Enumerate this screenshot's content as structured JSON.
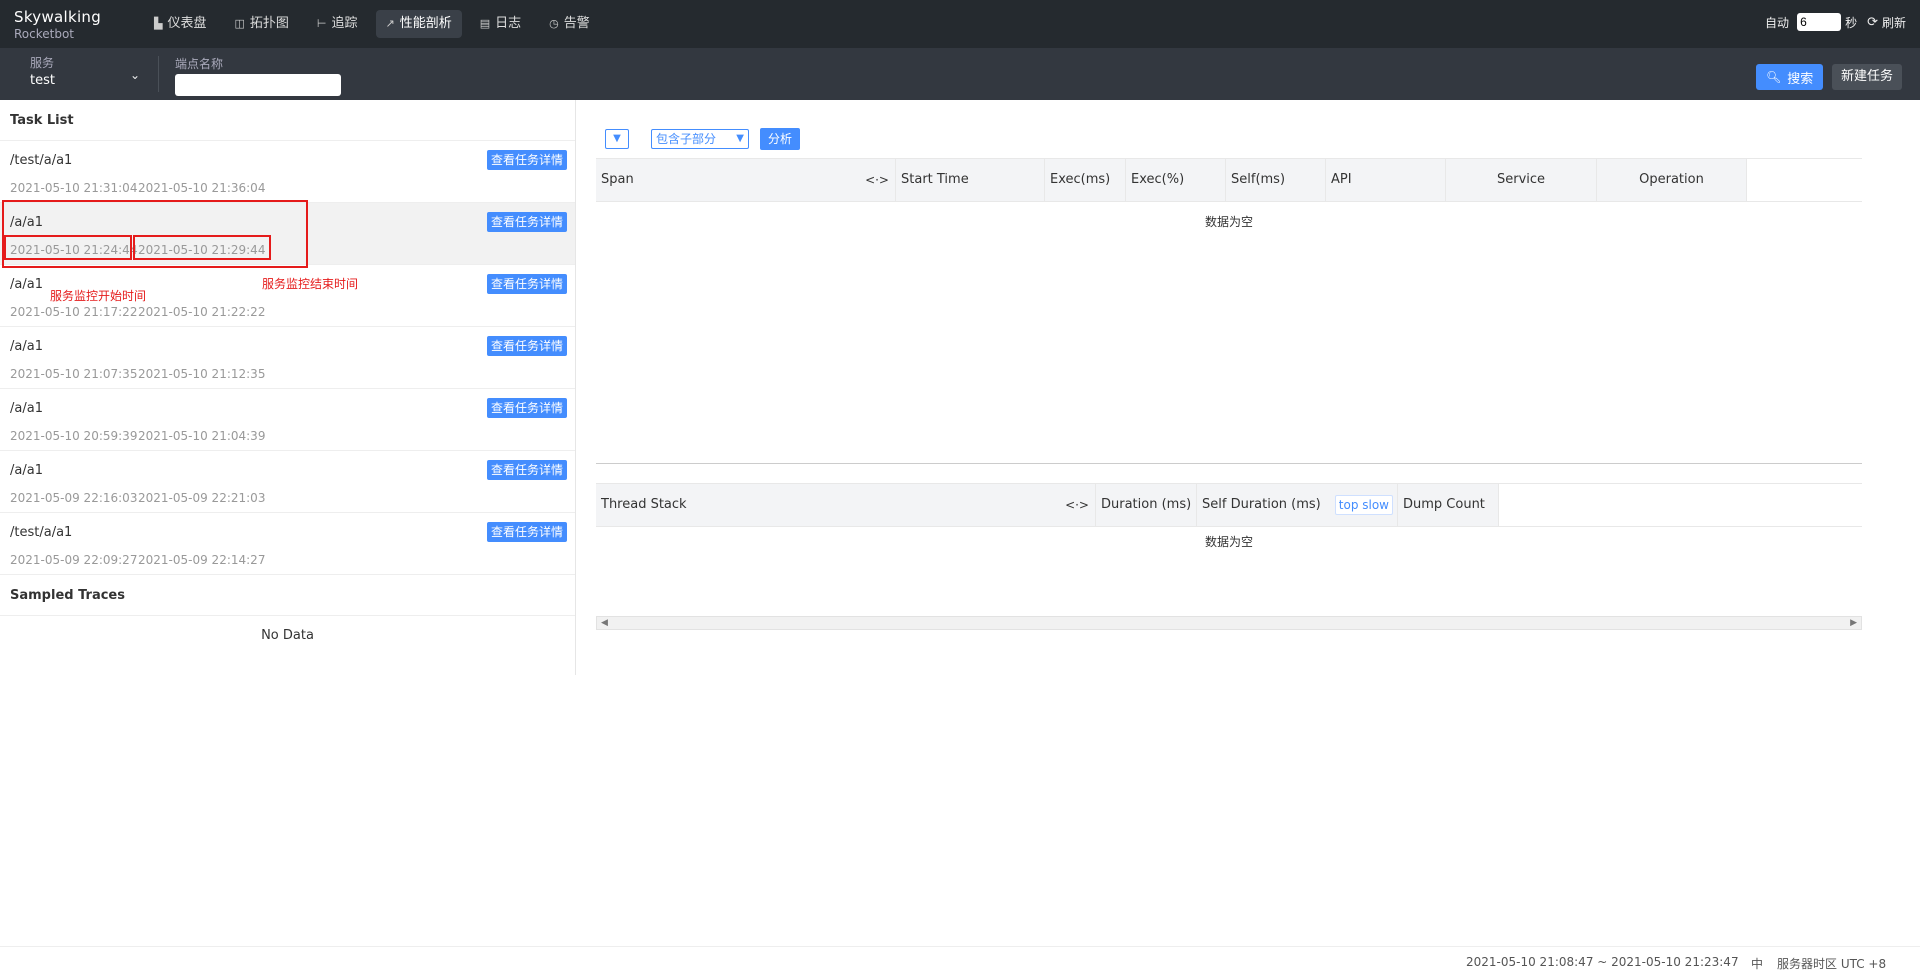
{
  "brand": {
    "title": "Skywalking",
    "subtitle": "Rocketbot"
  },
  "nav": [
    {
      "icon": "dashboard-icon",
      "glyph": "▙",
      "label": "仪表盘"
    },
    {
      "icon": "topology-icon",
      "glyph": "◫",
      "label": "拓扑图"
    },
    {
      "icon": "trace-icon",
      "glyph": "⊢",
      "label": "追踪"
    },
    {
      "icon": "profile-icon",
      "glyph": "↗",
      "label": "性能剖析"
    },
    {
      "icon": "log-icon",
      "glyph": "▤",
      "label": "日志"
    },
    {
      "icon": "alarm-icon",
      "glyph": "◷",
      "label": "告警"
    }
  ],
  "auto_refresh": {
    "label": "自动",
    "value": "6",
    "unit": "秒",
    "refresh_label": "刷新"
  },
  "filter": {
    "service_label": "服务",
    "service_value": "test",
    "endpoint_label": "端点名称",
    "endpoint_value": ""
  },
  "actions": {
    "search": "搜索",
    "new_task": "新建任务"
  },
  "task_list": {
    "title": "Task List",
    "detail_label": "查看任务详情",
    "tasks": [
      {
        "endpoint": "/test/a/a1",
        "start": "2021-05-10 21:31:04",
        "end": "2021-05-10 21:36:04"
      },
      {
        "endpoint": "/a/a1",
        "start": "2021-05-10 21:24:44",
        "end": "2021-05-10 21:29:44"
      },
      {
        "endpoint": "/a/a1",
        "start": "2021-05-10 21:17:22",
        "end": "2021-05-10 21:22:22"
      },
      {
        "endpoint": "/a/a1",
        "start": "2021-05-10 21:07:35",
        "end": "2021-05-10 21:12:35"
      },
      {
        "endpoint": "/a/a1",
        "start": "2021-05-10 20:59:39",
        "end": "2021-05-10 21:04:39"
      },
      {
        "endpoint": "/a/a1",
        "start": "2021-05-09 22:16:03",
        "end": "2021-05-09 22:21:03"
      },
      {
        "endpoint": "/test/a/a1",
        "start": "2021-05-09 22:09:27",
        "end": "2021-05-09 22:14:27"
      }
    ]
  },
  "annotations": {
    "start_note": "服务监控开始时间",
    "end_note": "服务监控结束时间"
  },
  "sampled": {
    "title": "Sampled Traces",
    "empty": "No Data"
  },
  "analysis": {
    "mini_select": "▼",
    "mode": "包含子部分",
    "mode_arrow": "▼",
    "analyze_label": "分析",
    "span_columns": [
      "Span",
      "Start Time",
      "Exec(ms)",
      "Exec(%)",
      "Self(ms)",
      "API",
      "Service",
      "Operation"
    ],
    "swap_glyph": "<·>",
    "span_empty": "数据为空",
    "thread_columns": [
      "Thread Stack",
      "Duration (ms)",
      "Self Duration (ms)",
      "Dump Count"
    ],
    "top_slow": "top slow",
    "thread_empty": "数据为空"
  },
  "footer": {
    "range": "2021-05-10 21:08:47 ~ 2021-05-10 21:23:47",
    "lang": "中",
    "timezone": "服务器时区 UTC +8"
  }
}
